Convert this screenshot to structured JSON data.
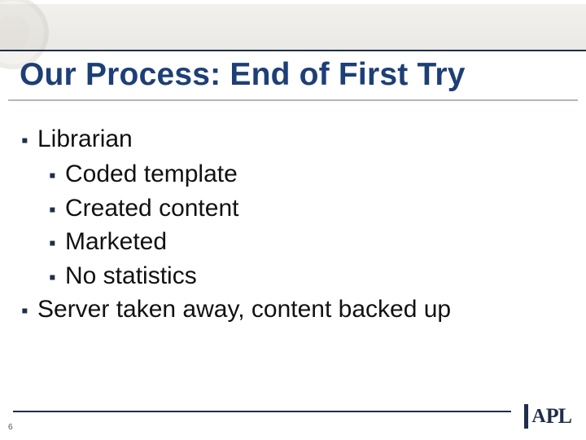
{
  "title": "Our Process: End of First Try",
  "bullets": {
    "level1": {
      "b0": "Librarian",
      "b1": "Server taken away, content backed up"
    },
    "level2": {
      "s0": "Coded template",
      "s1": "Created content",
      "s2": "Marketed",
      "s3": "No statistics"
    }
  },
  "footer": {
    "slide_number": "6",
    "logo_text_a": "A",
    "logo_text_pl": "PL"
  }
}
